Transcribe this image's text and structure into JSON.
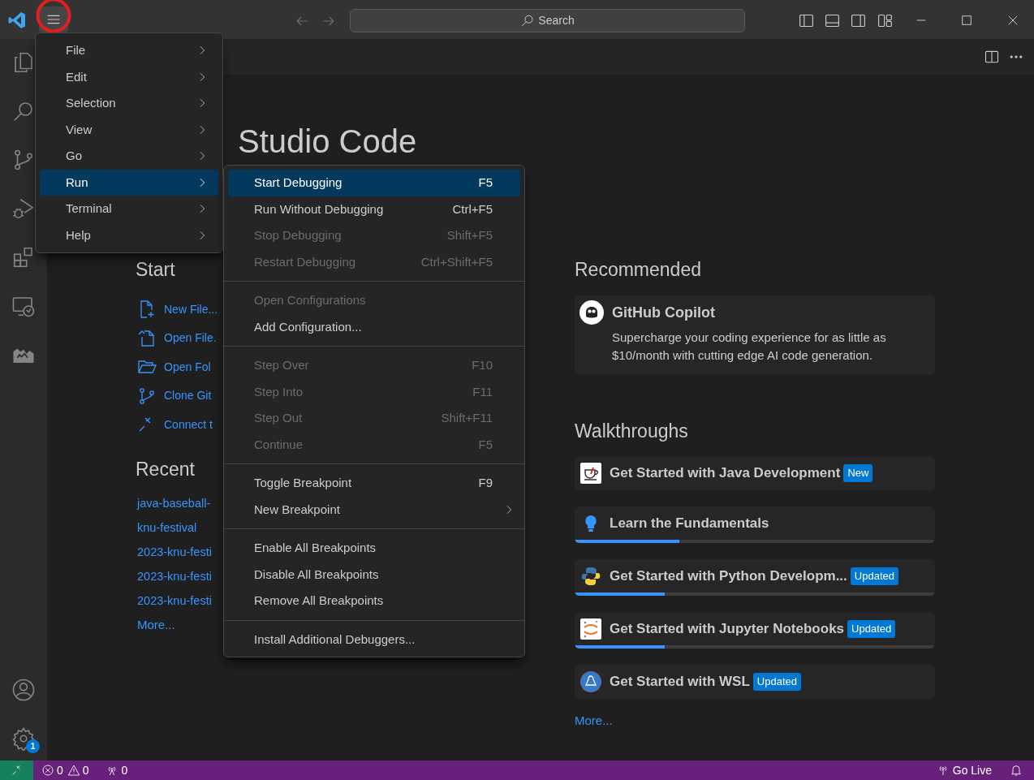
{
  "title_bar": {
    "search_placeholder": "Search"
  },
  "activity_bar": {
    "top": [
      {
        "kind": "explorer"
      },
      {
        "kind": "search"
      },
      {
        "kind": "scm"
      },
      {
        "kind": "debug"
      },
      {
        "kind": "extensions"
      },
      {
        "kind": "remote"
      },
      {
        "kind": "camel"
      }
    ],
    "bottom": [
      {
        "kind": "account"
      },
      {
        "kind": "settings",
        "badge": "1"
      }
    ]
  },
  "welcome": {
    "title": "Studio Code",
    "start": {
      "heading": "Start",
      "items": [
        {
          "kind": "new-file",
          "label": "New File..."
        },
        {
          "kind": "open-file",
          "label": "Open File."
        },
        {
          "kind": "open-folder",
          "label": "Open Fol"
        },
        {
          "kind": "clone",
          "label": "Clone Git"
        },
        {
          "kind": "connect",
          "label": "Connect t"
        }
      ]
    },
    "recent": {
      "heading": "Recent",
      "items": [
        "java-baseball-",
        "knu-festival",
        "2023-knu-festi",
        "2023-knu-festi",
        "2023-knu-festi"
      ],
      "more": "More..."
    },
    "recommended": {
      "heading": "Recommended",
      "card": {
        "title": "GitHub Copilot",
        "description": "Supercharge your coding experience for as little as $10/month with cutting edge AI code generation."
      }
    },
    "walkthroughs": {
      "heading": "Walkthroughs",
      "items": [
        {
          "kind": "java",
          "label": "Get Started with Java Development",
          "badge": "New"
        },
        {
          "kind": "bulb",
          "label": "Learn the Fundamentals",
          "level": 0.29
        },
        {
          "kind": "python",
          "label": "Get Started with Python Developm...",
          "badge": "Updated",
          "level": 0.25
        },
        {
          "kind": "jupyter",
          "label": "Get Started with Jupyter Notebooks",
          "badge": "Updated",
          "level": 0.25
        },
        {
          "kind": "wsl",
          "label": "Get Started with WSL",
          "badge": "Updated"
        }
      ],
      "more": "More..."
    }
  },
  "menu": {
    "items": [
      {
        "label": "File",
        "selected": false
      },
      {
        "label": "Edit",
        "selected": false
      },
      {
        "label": "Selection",
        "selected": false
      },
      {
        "label": "View",
        "selected": false
      },
      {
        "label": "Go",
        "selected": false
      },
      {
        "label": "Run",
        "selected": true
      },
      {
        "label": "Terminal",
        "selected": false
      },
      {
        "label": "Help",
        "selected": false
      }
    ]
  },
  "run_submenu": {
    "groups": [
      [
        {
          "label": "Start Debugging",
          "shortcut": "F5",
          "disabled": false,
          "selected": true
        },
        {
          "label": "Run Without Debugging",
          "shortcut": "Ctrl+F5",
          "disabled": false,
          "selected": false
        },
        {
          "label": "Stop Debugging",
          "shortcut": "Shift+F5",
          "disabled": true,
          "selected": false
        },
        {
          "label": "Restart Debugging",
          "shortcut": "Ctrl+Shift+F5",
          "disabled": true,
          "selected": false
        }
      ],
      [
        {
          "label": "Open Configurations",
          "disabled": true,
          "selected": false
        },
        {
          "label": "Add Configuration...",
          "disabled": false,
          "selected": false
        }
      ],
      [
        {
          "label": "Step Over",
          "shortcut": "F10",
          "disabled": true,
          "selected": false
        },
        {
          "label": "Step Into",
          "shortcut": "F11",
          "disabled": true,
          "selected": false
        },
        {
          "label": "Step Out",
          "shortcut": "Shift+F11",
          "disabled": true,
          "selected": false
        },
        {
          "label": "Continue",
          "shortcut": "F5",
          "disabled": true,
          "selected": false
        }
      ],
      [
        {
          "label": "Toggle Breakpoint",
          "shortcut": "F9",
          "disabled": false,
          "selected": false
        },
        {
          "label": "New Breakpoint",
          "submenu": true,
          "disabled": false,
          "selected": false
        }
      ],
      [
        {
          "label": "Enable All Breakpoints",
          "disabled": false,
          "selected": false
        },
        {
          "label": "Disable All Breakpoints",
          "disabled": false,
          "selected": false
        },
        {
          "label": "Remove All Breakpoints",
          "disabled": false,
          "selected": false
        }
      ],
      [
        {
          "label": "Install Additional Debuggers...",
          "disabled": false,
          "selected": false
        }
      ]
    ]
  },
  "status_bar": {
    "errors": "0",
    "warnings": "0",
    "ports": "0",
    "go_live": "Go Live"
  }
}
